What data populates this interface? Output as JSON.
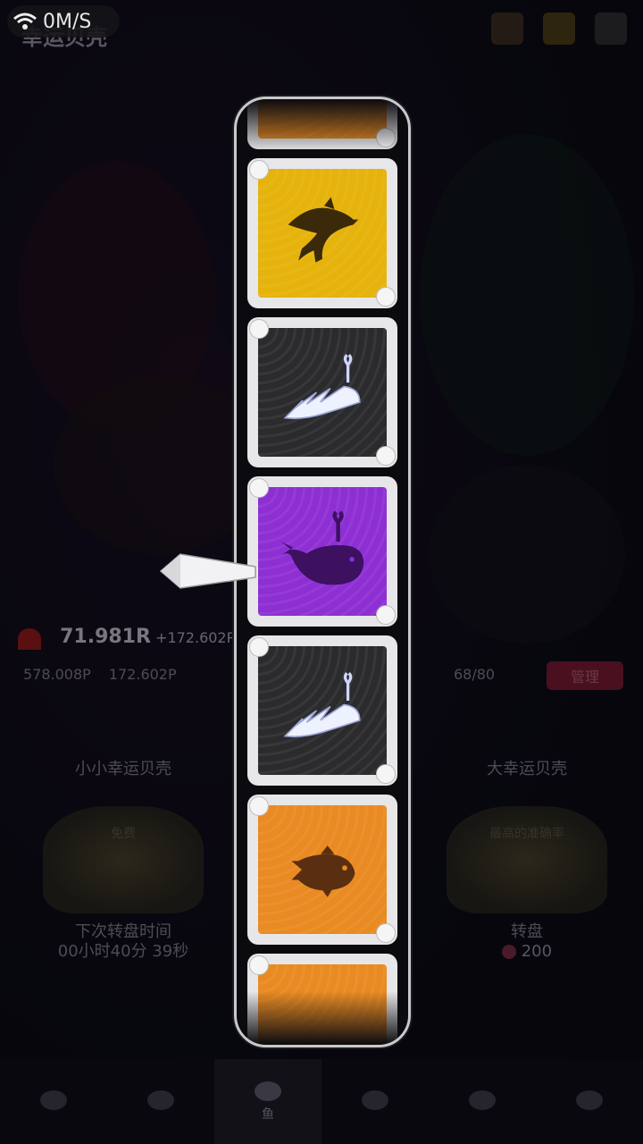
{
  "status": {
    "speed": "0M/S"
  },
  "background": {
    "title": "幸运贝壳",
    "score": "71.981R",
    "score_delta": "+172.602P",
    "stat_a": "578.008P",
    "stat_b": "172.602P",
    "fish_count": "68/80",
    "manage_label": "管理",
    "left_panel": {
      "title": "小小幸运贝壳",
      "badge": "免费",
      "foot_line1": "下次转盘时间",
      "foot_line2": "00小时40分 39秒"
    },
    "right_panel": {
      "title": "大幸运贝壳",
      "badge": "最高的准确率",
      "foot_line1": "转盘",
      "cost": "200"
    },
    "nav": [
      {
        "label": ""
      },
      {
        "label": ""
      },
      {
        "label": "鱼"
      },
      {
        "label": ""
      },
      {
        "label": ""
      },
      {
        "label": ""
      }
    ]
  },
  "reel": {
    "cards": [
      {
        "color": "#e98a22",
        "icon": "partial-icon"
      },
      {
        "color": "#e5b30b",
        "icon": "dolphin-icon"
      },
      {
        "color": "#2b2b2e",
        "icon": "white-whale-icon"
      },
      {
        "color": "#8d2fd3",
        "icon": "whale-icon",
        "selected": true
      },
      {
        "color": "#2b2b2e",
        "icon": "white-whale-icon"
      },
      {
        "color": "#e98a22",
        "icon": "clownfish-icon"
      },
      {
        "color": "#e98a22",
        "icon": "partial-icon"
      }
    ]
  }
}
